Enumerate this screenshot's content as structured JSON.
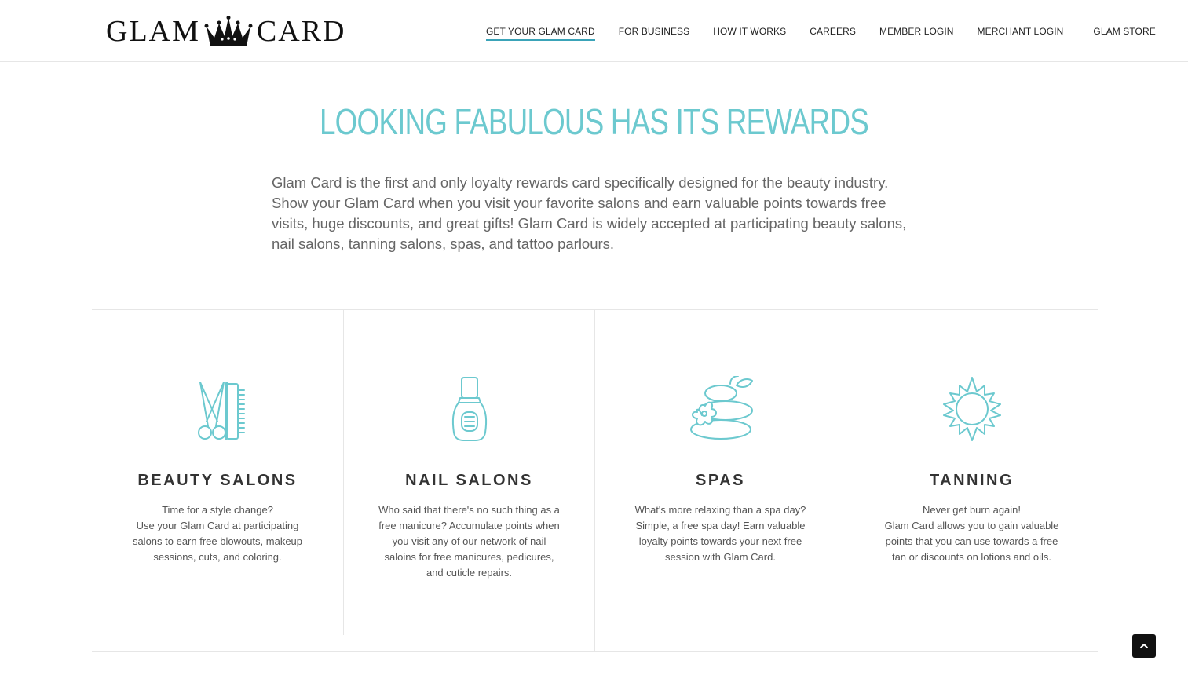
{
  "brand": {
    "word_left": "GLAM",
    "word_right": "CARD"
  },
  "nav": {
    "items": [
      {
        "label": "GET YOUR GLAM CARD",
        "active": true
      },
      {
        "label": "FOR BUSINESS"
      },
      {
        "label": "HOW IT WORKS"
      },
      {
        "label": "CAREERS"
      },
      {
        "label": "MEMBER LOGIN"
      },
      {
        "label": "MERCHANT LOGIN"
      },
      {
        "label": "GLAM STORE"
      }
    ]
  },
  "hero": {
    "title": "LOOKING FABULOUS HAS ITS REWARDS",
    "body": "Glam Card is the first and only loyalty rewards card specifically designed for the beauty industry. Show your Glam Card when you visit your favorite salons and earn valuable points towards free visits, huge discounts, and great gifts! Glam Card is widely accepted at participating beauty salons, nail salons, tanning salons, spas, and tattoo parlours."
  },
  "features": [
    {
      "icon": "scissors-comb-icon",
      "title": "BEAUTY SALONS",
      "text": "Time for a style change?\nUse your Glam Card at participating salons to earn free blowouts, makeup sessions, cuts, and coloring."
    },
    {
      "icon": "nail-polish-icon",
      "title": "NAIL SALONS",
      "text": "Who said that there's no such thing as a free manicure? Accumulate points when you visit any of our network of nail saloins for free manicures, pedicures, and cuticle repairs."
    },
    {
      "icon": "spa-stones-icon",
      "title": "SPAS",
      "text": "What's more relaxing than a spa day? Simple, a free spa day! Earn valuable loyalty points towards your next free session with Glam Card."
    },
    {
      "icon": "sun-icon",
      "title": "TANNING",
      "text": "Never get burn again!\nGlam Card allows you to gain valuable points that you can use towards a free tan or discounts on lotions and oils."
    }
  ],
  "colors": {
    "accent": "#6cc9cf",
    "nav_underline": "#3aa3b8"
  }
}
